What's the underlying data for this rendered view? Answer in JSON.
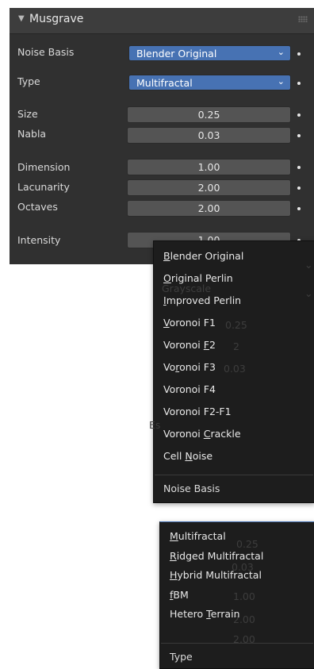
{
  "panel": {
    "title": "Musgrave",
    "rows": {
      "noise_basis": {
        "label": "Noise Basis",
        "value": "Blender Original"
      },
      "type": {
        "label": "Type",
        "value": "Multifractal"
      },
      "size": {
        "label": "Size",
        "value": "0.25"
      },
      "nabla": {
        "label": "Nabla",
        "value": "0.03"
      },
      "dimension": {
        "label": "Dimension",
        "value": "1.00"
      },
      "lacunarity": {
        "label": "Lacunarity",
        "value": "2.00"
      },
      "octaves": {
        "label": "Octaves",
        "value": "2.00"
      },
      "intensity": {
        "label": "Intensity",
        "value": "1.00"
      }
    }
  },
  "noise_menu": {
    "items": [
      {
        "pre": "",
        "key": "B",
        "post": "lender Original"
      },
      {
        "pre": "",
        "key": "O",
        "post": "riginal Perlin"
      },
      {
        "pre": "",
        "key": "I",
        "post": "mproved Perlin"
      },
      {
        "pre": "",
        "key": "V",
        "post": "oronoi F1"
      },
      {
        "pre": "Voronoi ",
        "key": "F",
        "post": "2"
      },
      {
        "pre": "Vo",
        "key": "r",
        "post": "onoi F3"
      },
      {
        "pre": "Voronoi F4",
        "key": "",
        "post": ""
      },
      {
        "pre": "Voronoi F2-F1",
        "key": "",
        "post": ""
      },
      {
        "pre": "Voronoi ",
        "key": "C",
        "post": "rackle"
      },
      {
        "pre": "Cell ",
        "key": "N",
        "post": "oise"
      }
    ],
    "title": "Noise Basis",
    "ghost": {
      "val1": "0.25",
      "val2": "2",
      "val3": "0.03",
      "frag1": "Grayscale",
      "frag2": "Es"
    }
  },
  "type_menu": {
    "items": [
      {
        "pre": "",
        "key": "M",
        "post": "ultifractal"
      },
      {
        "pre": "",
        "key": "R",
        "post": "idged Multifractal"
      },
      {
        "pre": "",
        "key": "H",
        "post": "ybrid Multifractal"
      },
      {
        "pre": "",
        "key": "f",
        "post": "BM"
      },
      {
        "pre": "Hetero ",
        "key": "T",
        "post": "errain"
      }
    ],
    "title": "Type",
    "ghost": {
      "val1": "0.25",
      "val2": "0.03",
      "val3": "1.00",
      "val4": "2.00",
      "val5": "2.00"
    }
  },
  "icons": {
    "collapse": "disclosure-triangle-down",
    "dropdown": "chevron-down",
    "keyframe": "decorate-dot",
    "drag": "panel-grip"
  }
}
